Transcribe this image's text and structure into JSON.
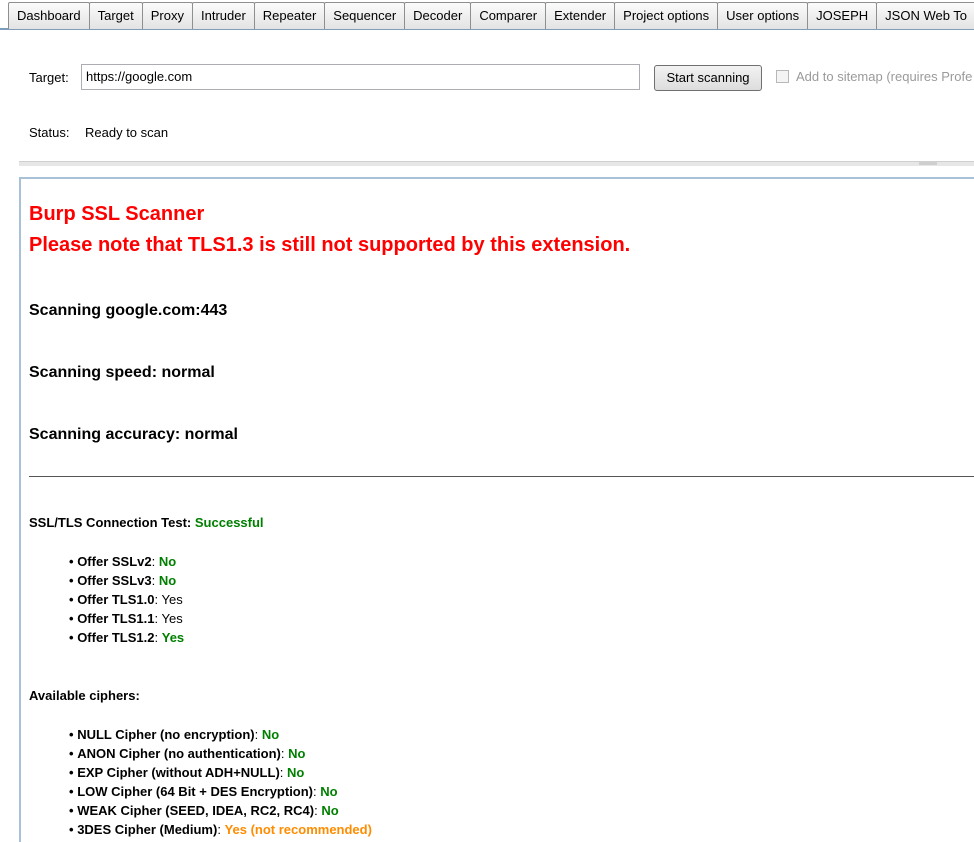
{
  "tabs": [
    "Dashboard",
    "Target",
    "Proxy",
    "Intruder",
    "Repeater",
    "Sequencer",
    "Decoder",
    "Comparer",
    "Extender",
    "Project options",
    "User options",
    "JOSEPH",
    "JSON Web To"
  ],
  "form": {
    "target_label": "Target:",
    "target_value": "https://google.com",
    "start_button": "Start scanning",
    "sitemap_label": "Add to sitemap (requires Profe",
    "sitemap_checked": false,
    "status_label": "Status:",
    "status_value": "Ready to scan"
  },
  "results": {
    "title": "Burp SSL Scanner",
    "note": "Please note that TLS1.3 is still not supported by this extension.",
    "scanning_host": "Scanning google.com:443",
    "scanning_speed": "Scanning speed: normal",
    "scanning_accuracy": "Scanning accuracy: normal",
    "connection_test_label": "SSL/TLS Connection Test:",
    "connection_test_result": "Successful",
    "protocols": [
      {
        "bullet": "•",
        "label": "Offer SSLv2",
        "sep": ":",
        "value": "No"
      },
      {
        "bullet": "•",
        "label": "Offer SSLv3",
        "sep": ":",
        "value": "No"
      },
      {
        "bullet": "•",
        "label": "Offer TLS1.0",
        "sep": ":",
        "value": "Yes"
      },
      {
        "bullet": "•",
        "label": "Offer TLS1.1",
        "sep": ":",
        "value": "Yes"
      },
      {
        "bullet": "•",
        "label": "Offer TLS1.2",
        "sep": ":",
        "value": "Yes"
      }
    ],
    "ciphers_label": "Available ciphers:",
    "ciphers": [
      {
        "bullet": "•",
        "label": "NULL Cipher (no encryption)",
        "sep": ":",
        "value": "No"
      },
      {
        "bullet": "•",
        "label": "ANON Cipher (no authentication)",
        "sep": ":",
        "value": "No"
      },
      {
        "bullet": "•",
        "label": "EXP Cipher (without ADH+NULL)",
        "sep": ":",
        "value": "No"
      },
      {
        "bullet": "•",
        "label": "LOW Cipher (64 Bit + DES Encryption)",
        "sep": ":",
        "value": "No"
      },
      {
        "bullet": "•",
        "label": "WEAK Cipher (SEED, IDEA, RC2, RC4)",
        "sep": ":",
        "value": "No"
      },
      {
        "bullet": "•",
        "label": "3DES Cipher (Medium)",
        "sep": ":",
        "value": "Yes (not recommended)"
      }
    ]
  }
}
